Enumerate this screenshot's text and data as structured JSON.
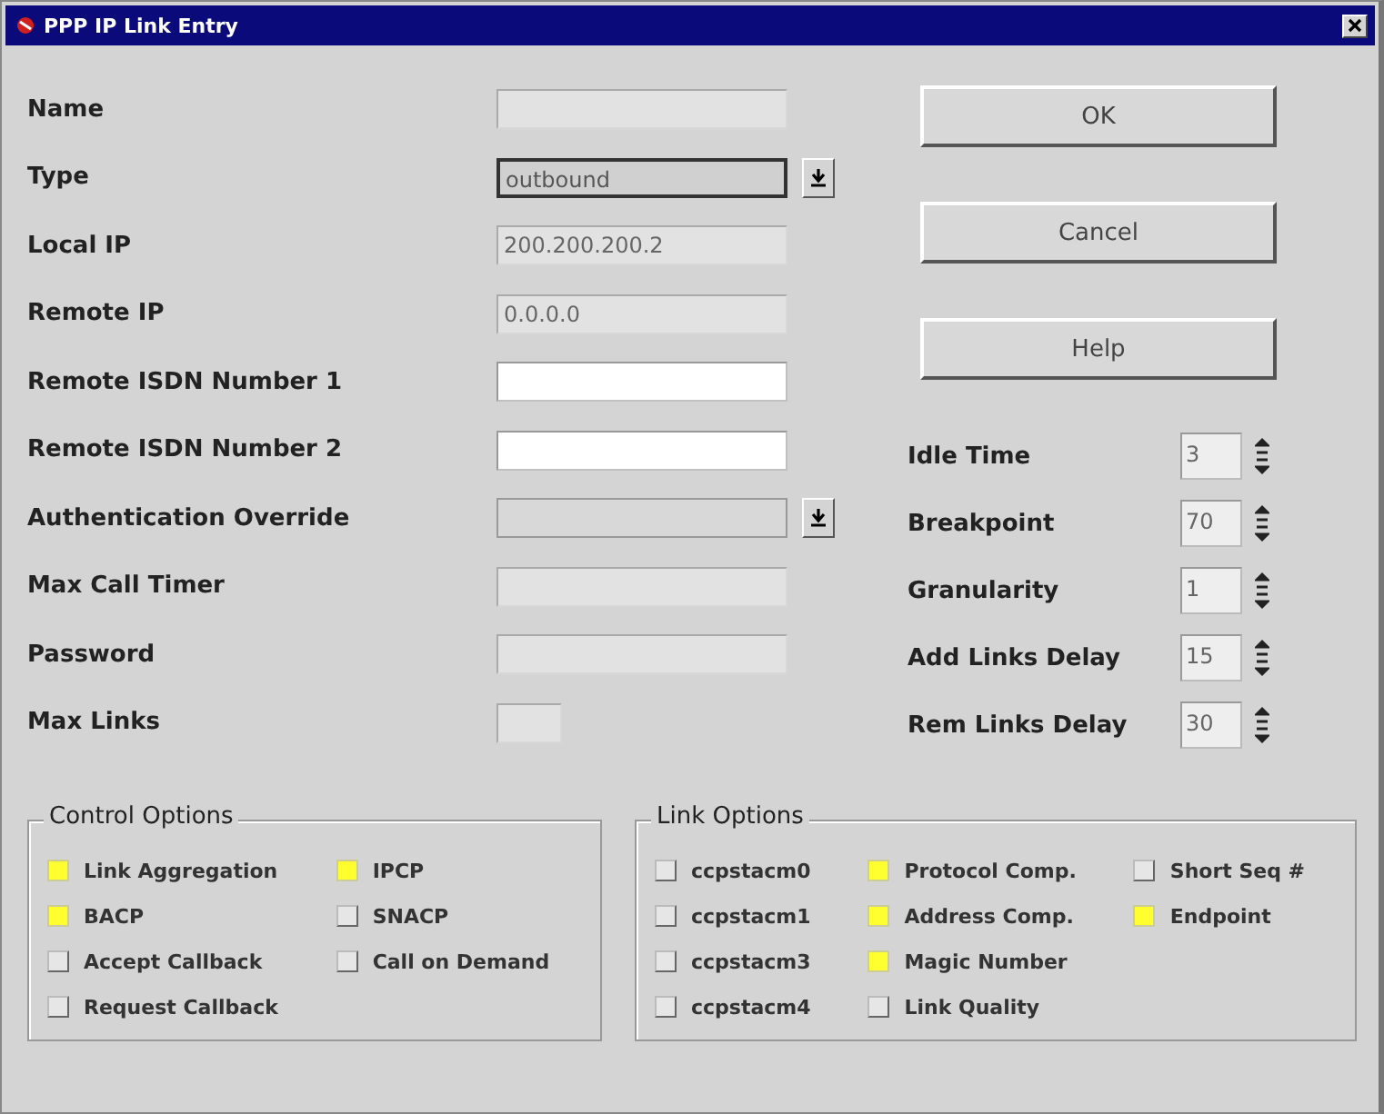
{
  "window": {
    "title": "PPP IP Link Entry"
  },
  "fields": [
    {
      "label": "Name",
      "kind": "text",
      "disabled": true,
      "focused": false
    },
    {
      "label": "Type",
      "kind": "dropdown",
      "value": "outbound",
      "disabled": true,
      "focused": true
    },
    {
      "label": "Local IP",
      "kind": "text",
      "value": "200.200.200.2",
      "disabled": true,
      "focused": false
    },
    {
      "label": "Remote IP",
      "kind": "text",
      "value": "0.0.0.0",
      "disabled": true,
      "focused": false
    },
    {
      "label": "Remote ISDN Number 1",
      "kind": "text",
      "disabled": false,
      "focused": false
    },
    {
      "label": "Remote ISDN Number 2",
      "kind": "text",
      "disabled": false,
      "focused": false
    },
    {
      "label": "Authentication Override",
      "kind": "dropdown",
      "disabled": true,
      "focused": false
    },
    {
      "label": "Max Call Timer",
      "kind": "text",
      "disabled": true,
      "focused": false
    },
    {
      "label": "Password",
      "kind": "text",
      "disabled": true,
      "focused": false
    },
    {
      "label": "Max Links",
      "kind": "short",
      "disabled": true,
      "focused": false
    }
  ],
  "buttons": [
    "OK",
    "Cancel",
    "Help"
  ],
  "spinners": [
    {
      "label": "Idle Time",
      "value": "3"
    },
    {
      "label": "Breakpoint",
      "value": "70"
    },
    {
      "label": "Granularity",
      "value": "1"
    },
    {
      "label": "Add Links Delay",
      "value": "15"
    },
    {
      "label": "Rem Links Delay",
      "value": "30"
    }
  ],
  "groups": [
    {
      "title": "Control Options",
      "rows": [
        [
          {
            "label": "Link Aggregation",
            "checked": true
          },
          {
            "label": "IPCP",
            "checked": true
          }
        ],
        [
          {
            "label": "BACP",
            "checked": true
          },
          {
            "label": "SNACP",
            "checked": false
          }
        ],
        [
          {
            "label": "Accept Callback",
            "checked": false
          },
          {
            "label": "Call on Demand",
            "checked": false
          }
        ],
        [
          {
            "label": "Request Callback",
            "checked": false
          }
        ]
      ]
    },
    {
      "title": "Link Options",
      "rows": [
        [
          {
            "label": "ccpstacm0",
            "checked": false
          },
          {
            "label": "Protocol Comp.",
            "checked": true
          },
          {
            "label": "Short Seq #",
            "checked": false
          }
        ],
        [
          {
            "label": "ccpstacm1",
            "checked": false
          },
          {
            "label": "Address Comp.",
            "checked": true
          },
          {
            "label": "Endpoint",
            "checked": true
          }
        ],
        [
          {
            "label": "ccpstacm3",
            "checked": false
          },
          {
            "label": "Magic Number",
            "checked": true
          }
        ],
        [
          {
            "label": "ccpstacm4",
            "checked": false
          },
          {
            "label": "Link Quality",
            "checked": false
          }
        ]
      ]
    }
  ]
}
